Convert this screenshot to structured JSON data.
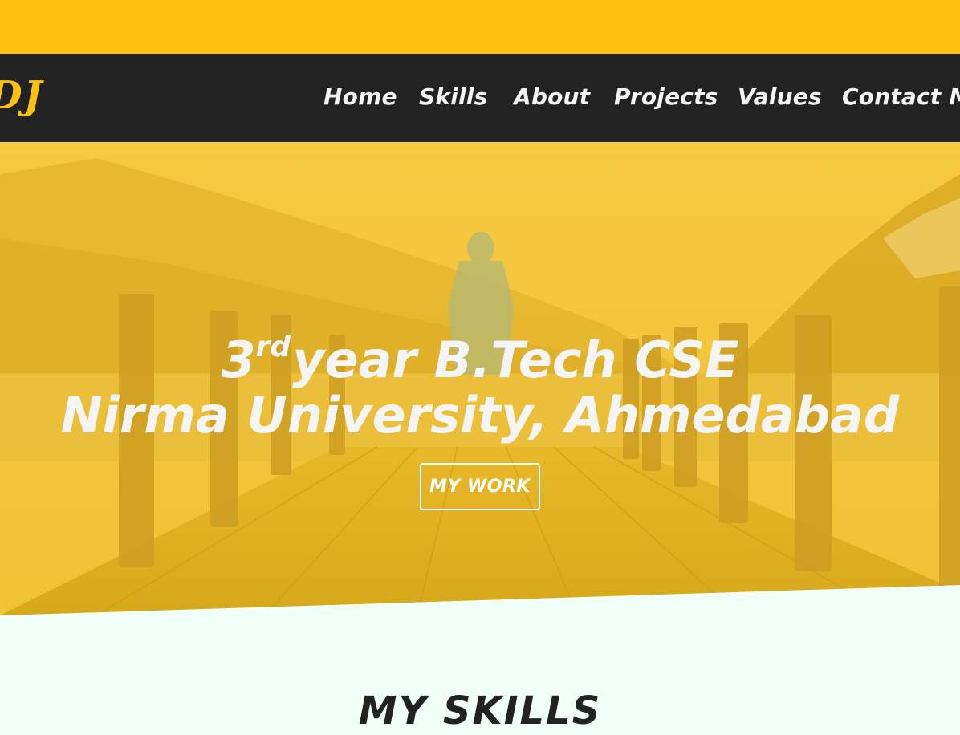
{
  "header": {
    "logo": "DJ"
  },
  "nav": {
    "items": [
      {
        "label": "Home"
      },
      {
        "label": "Skills"
      },
      {
        "label": "About"
      },
      {
        "label": "Projects"
      },
      {
        "label": "Values"
      },
      {
        "label": "Contact Me"
      }
    ]
  },
  "hero": {
    "line1_number": "3",
    "line1_superscript": "rd",
    "line1_rest": "year B.Tech CSE",
    "line2": "Nirma University, Ahmedabad",
    "button_label": "MY WORK"
  },
  "skills": {
    "title": "MY SKILLS"
  },
  "colors": {
    "accent": "#ffc00f",
    "navbar": "#222222",
    "section_bg": "#f0fff8",
    "hero_overlay": "#f3c230"
  }
}
